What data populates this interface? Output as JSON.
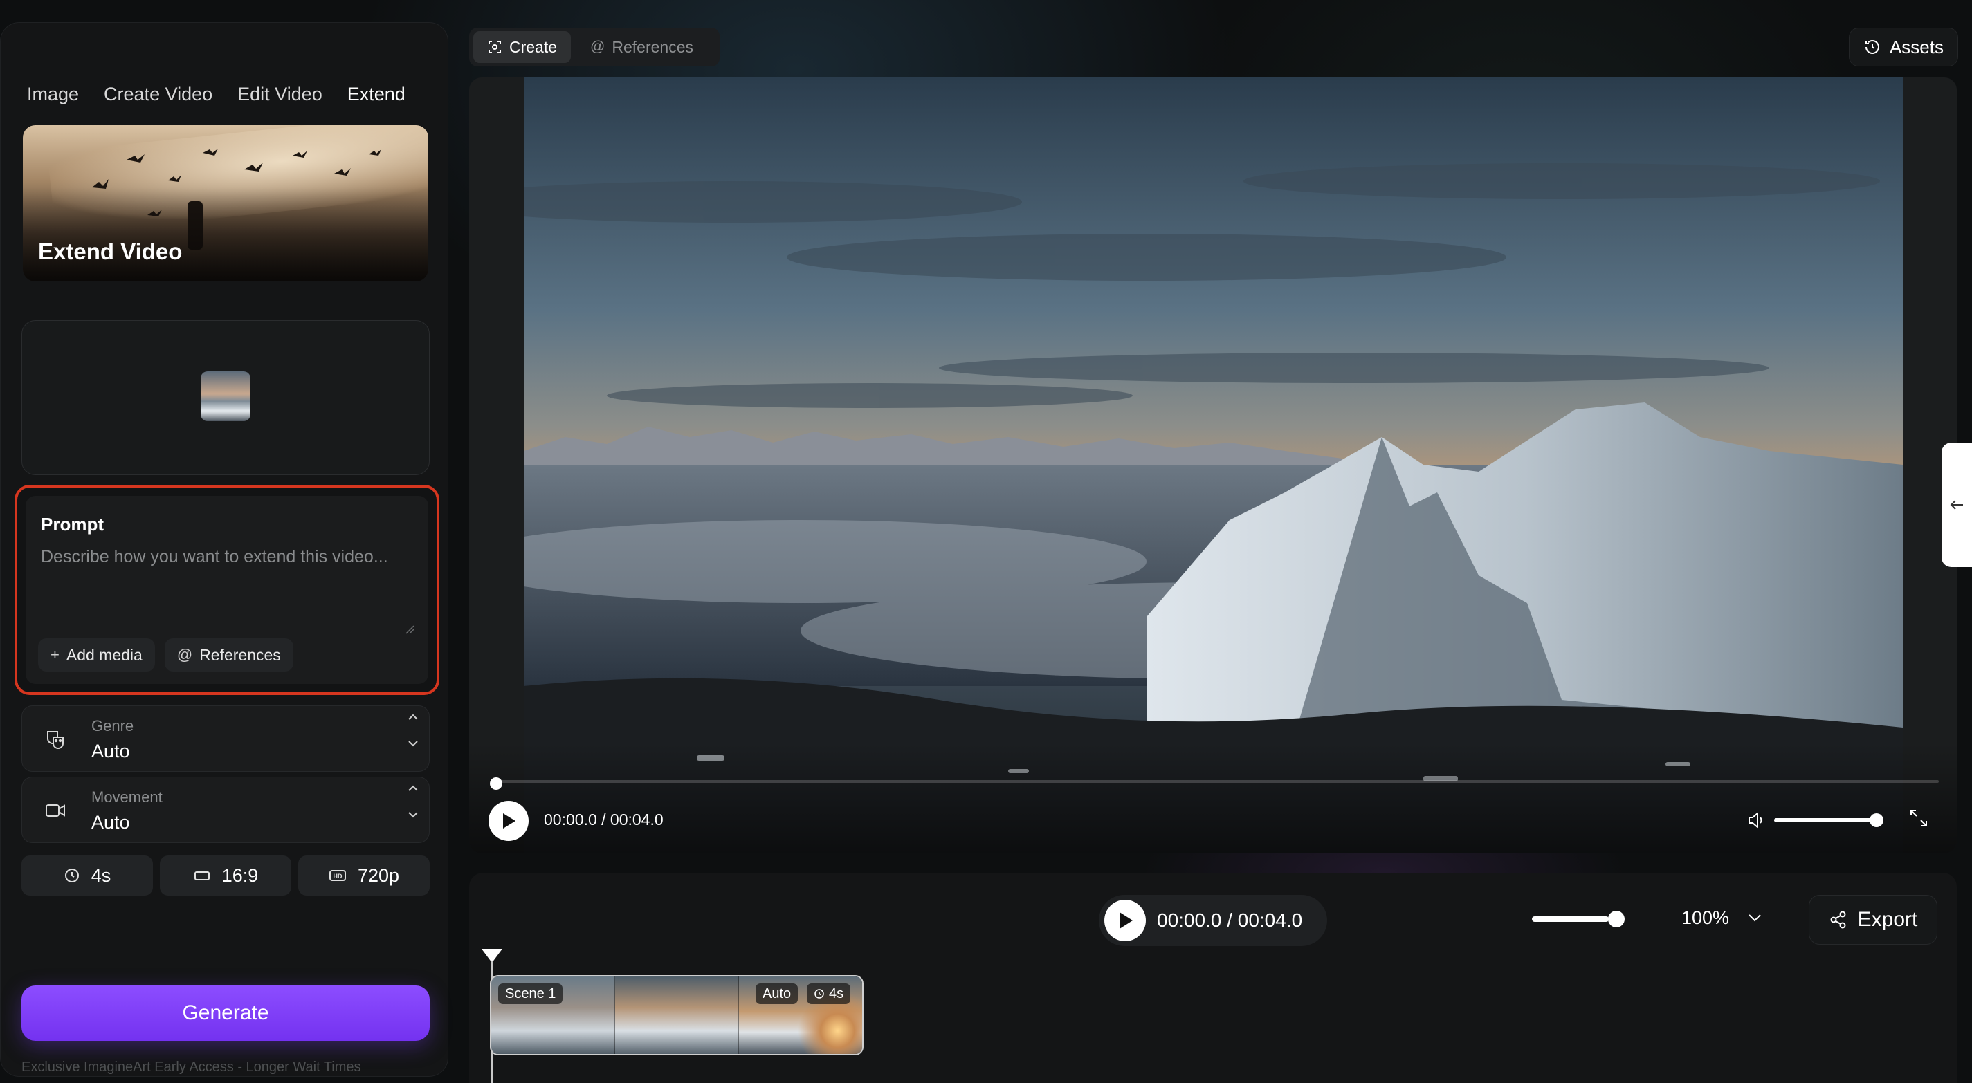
{
  "tabs": [
    {
      "label": "Image"
    },
    {
      "label": "Create Video"
    },
    {
      "label": "Edit Video"
    },
    {
      "label": "Extend",
      "active": true
    }
  ],
  "hero": {
    "title": "Extend Video"
  },
  "prompt": {
    "label": "Prompt",
    "placeholder": "Describe how you want to extend this video...",
    "value": "",
    "add_media_label": "Add media",
    "references_label": "References"
  },
  "genre": {
    "caption": "Genre",
    "value": "Auto",
    "icon": "masks-icon"
  },
  "movement": {
    "caption": "Movement",
    "value": "Auto",
    "icon": "video-camera-icon"
  },
  "options": {
    "duration": "4s",
    "aspect_ratio": "16:9",
    "resolution": "720p"
  },
  "generate": {
    "label": "Generate",
    "note": "Exclusive ImagineArt Early Access - Longer Wait Times"
  },
  "top_bar": {
    "create_label": "Create",
    "references_label": "References",
    "assets_label": "Assets"
  },
  "player": {
    "time": "00:00.0 / 00:04.0",
    "volume": 1.0,
    "progress": 0.0
  },
  "timeline": {
    "time": "00:00.0 / 00:04.0",
    "zoom": "100%",
    "zoom_level": 0.85,
    "export_label": "Export",
    "clip": {
      "scene_label": "Scene 1",
      "mode_label": "Auto",
      "duration_label": "4s"
    }
  },
  "colors": {
    "accent": "#7c3aed",
    "highlight_border": "#d6361f"
  }
}
